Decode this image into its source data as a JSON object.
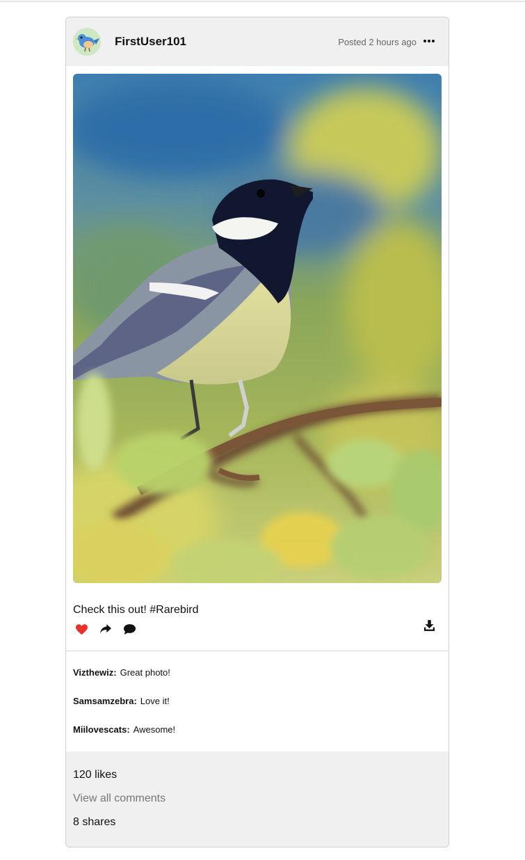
{
  "post": {
    "username": "FirstUser101",
    "posted": "Posted 2 hours ago",
    "caption": "Check this out! #Rarebird",
    "comments": [
      {
        "author": "Vizthewiz:",
        "text": "Great photo!"
      },
      {
        "author": "Samsamzebra:",
        "text": "Love it!"
      },
      {
        "author": "Miilovescats:",
        "text": "Awesome!"
      }
    ],
    "likes": "120 likes",
    "view_all": "View all comments",
    "shares": "8 shares"
  },
  "colors": {
    "header_bg": "#f0f0f0",
    "heart": "#e8322b",
    "muted": "#777777"
  },
  "icons": [
    "bird-avatar-icon",
    "more-options-icon",
    "heart-icon",
    "share-icon",
    "comment-icon",
    "download-icon"
  ]
}
